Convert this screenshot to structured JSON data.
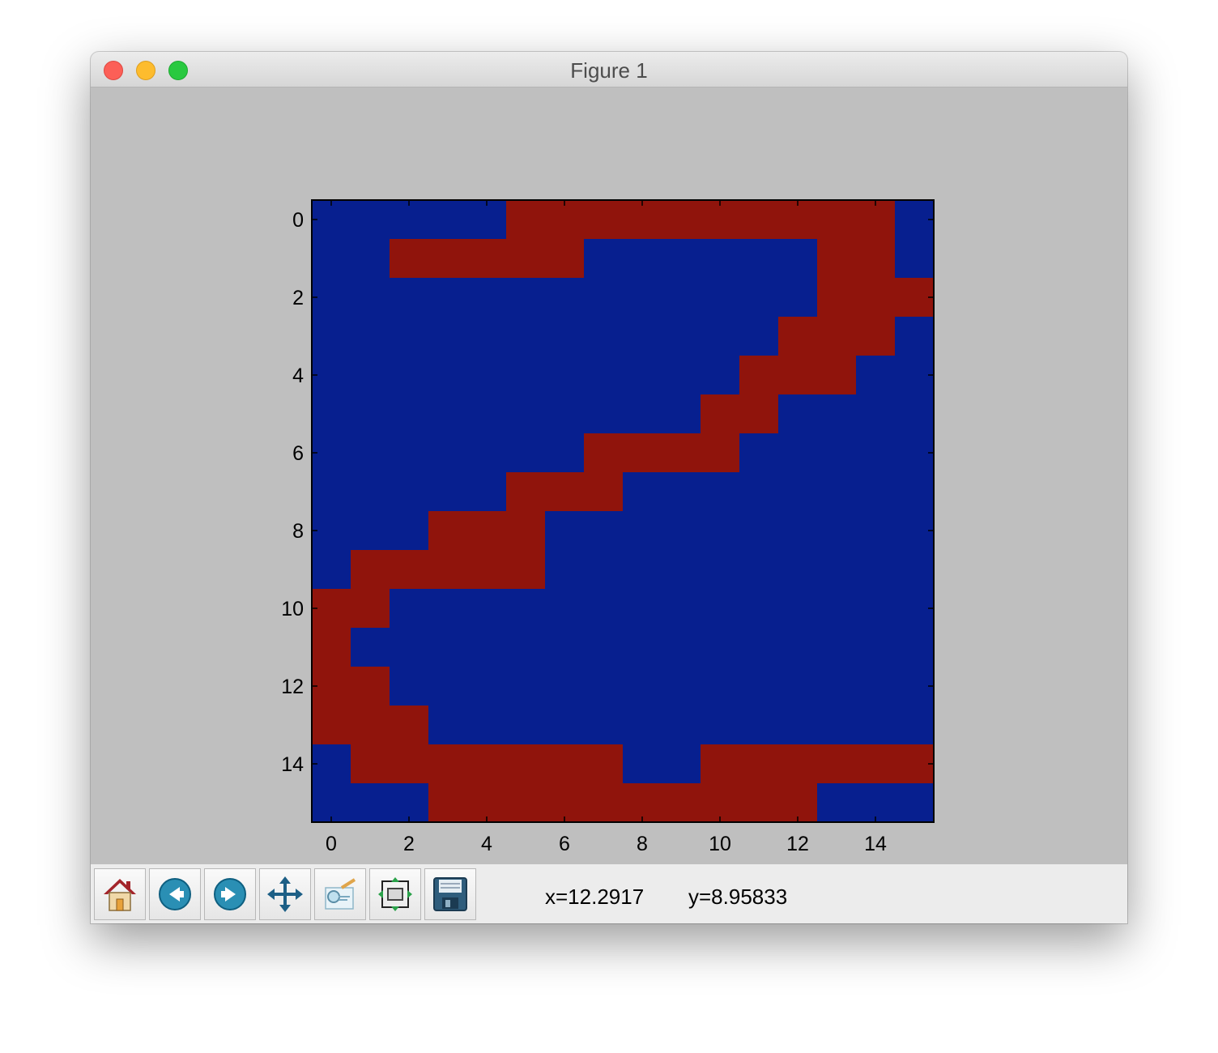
{
  "window": {
    "title": "Figure 1"
  },
  "toolbar": {
    "buttons": [
      {
        "name": "home-button",
        "icon": "home-icon"
      },
      {
        "name": "back-button",
        "icon": "back-arrow-icon"
      },
      {
        "name": "forward-button",
        "icon": "forward-arrow-icon"
      },
      {
        "name": "pan-button",
        "icon": "move-arrows-icon"
      },
      {
        "name": "zoom-button",
        "icon": "zoom-rect-icon"
      },
      {
        "name": "subplots-button",
        "icon": "configure-subplots-icon"
      },
      {
        "name": "save-button",
        "icon": "floppy-disk-icon"
      }
    ],
    "x_readout": "x=12.2917",
    "y_readout": "y=8.95833"
  },
  "chart_data": {
    "type": "heatmap",
    "colors": {
      "0": "#071f8f",
      "1": "#90140c"
    },
    "x_ticks": [
      "0",
      "2",
      "4",
      "6",
      "8",
      "10",
      "12",
      "14"
    ],
    "y_ticks": [
      "0",
      "2",
      "4",
      "6",
      "8",
      "10",
      "12",
      "14"
    ],
    "xlim": [
      -0.5,
      15.5
    ],
    "ylim": [
      15.5,
      -0.5
    ],
    "grid": false,
    "matrix": [
      [
        0,
        0,
        0,
        0,
        0,
        1,
        1,
        1,
        1,
        1,
        1,
        1,
        1,
        1,
        1,
        0
      ],
      [
        0,
        0,
        1,
        1,
        1,
        1,
        1,
        0,
        0,
        0,
        0,
        0,
        0,
        1,
        1,
        0
      ],
      [
        0,
        0,
        0,
        0,
        0,
        0,
        0,
        0,
        0,
        0,
        0,
        0,
        0,
        1,
        1,
        1
      ],
      [
        0,
        0,
        0,
        0,
        0,
        0,
        0,
        0,
        0,
        0,
        0,
        0,
        1,
        1,
        1,
        0
      ],
      [
        0,
        0,
        0,
        0,
        0,
        0,
        0,
        0,
        0,
        0,
        0,
        1,
        1,
        1,
        0,
        0
      ],
      [
        0,
        0,
        0,
        0,
        0,
        0,
        0,
        0,
        0,
        0,
        1,
        1,
        0,
        0,
        0,
        0
      ],
      [
        0,
        0,
        0,
        0,
        0,
        0,
        0,
        1,
        1,
        1,
        1,
        0,
        0,
        0,
        0,
        0
      ],
      [
        0,
        0,
        0,
        0,
        0,
        1,
        1,
        1,
        0,
        0,
        0,
        0,
        0,
        0,
        0,
        0
      ],
      [
        0,
        0,
        0,
        1,
        1,
        1,
        0,
        0,
        0,
        0,
        0,
        0,
        0,
        0,
        0,
        0
      ],
      [
        0,
        1,
        1,
        1,
        1,
        1,
        0,
        0,
        0,
        0,
        0,
        0,
        0,
        0,
        0,
        0
      ],
      [
        1,
        1,
        0,
        0,
        0,
        0,
        0,
        0,
        0,
        0,
        0,
        0,
        0,
        0,
        0,
        0
      ],
      [
        1,
        0,
        0,
        0,
        0,
        0,
        0,
        0,
        0,
        0,
        0,
        0,
        0,
        0,
        0,
        0
      ],
      [
        1,
        1,
        0,
        0,
        0,
        0,
        0,
        0,
        0,
        0,
        0,
        0,
        0,
        0,
        0,
        0
      ],
      [
        1,
        1,
        1,
        0,
        0,
        0,
        0,
        0,
        0,
        0,
        0,
        0,
        0,
        0,
        0,
        0
      ],
      [
        0,
        1,
        1,
        1,
        1,
        1,
        1,
        1,
        0,
        0,
        1,
        1,
        1,
        1,
        1,
        1
      ],
      [
        0,
        0,
        0,
        1,
        1,
        1,
        1,
        1,
        1,
        1,
        1,
        1,
        1,
        0,
        0,
        0
      ]
    ]
  }
}
